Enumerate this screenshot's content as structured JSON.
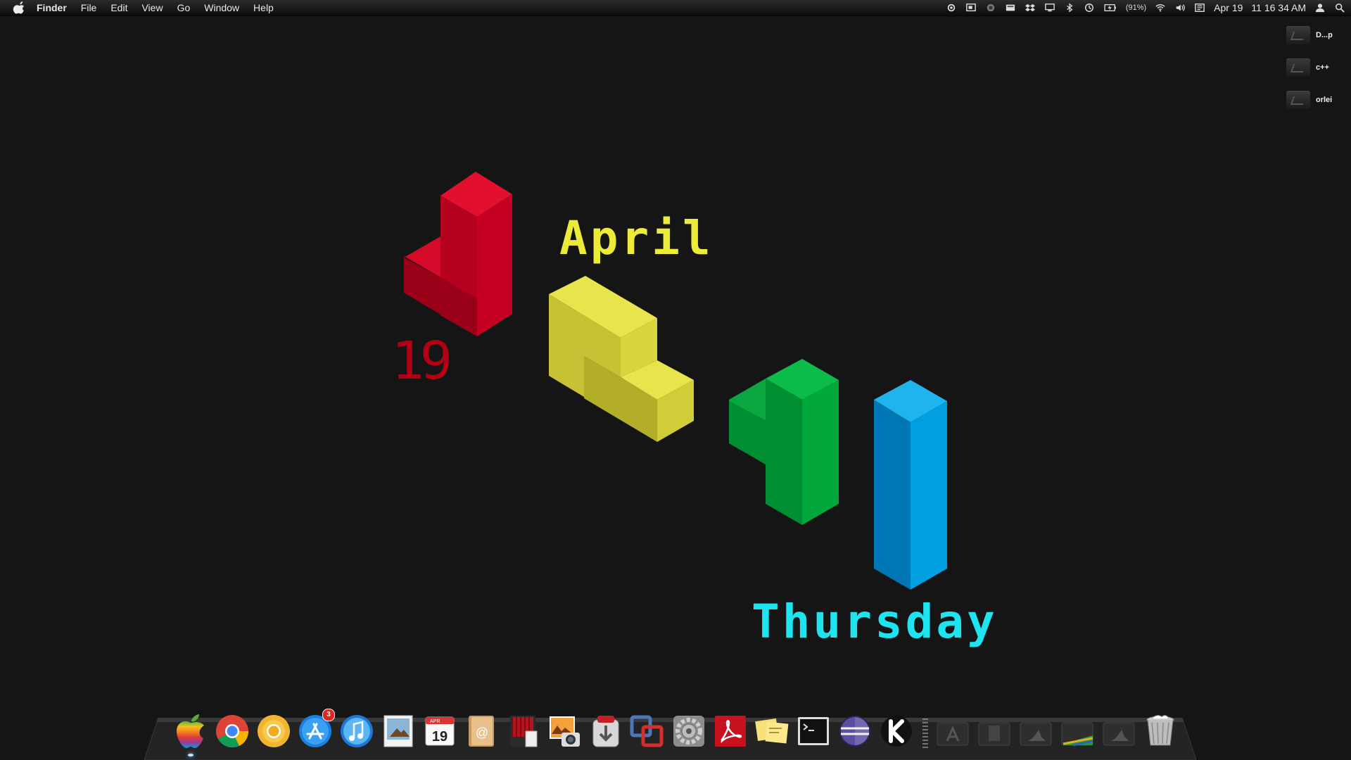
{
  "menubar": {
    "app_name": "Finder",
    "menus": [
      "File",
      "Edit",
      "View",
      "Go",
      "Window",
      "Help"
    ],
    "status_icons": [
      "sync-icon",
      "screen-capture-icon",
      "chat-icon",
      "keyboard-icon",
      "dropbox-icon",
      "display-icon",
      "bluetooth-icon",
      "time-machine-icon",
      "battery-icon",
      "wifi-icon",
      "volume-icon",
      "input-menu-icon"
    ],
    "battery_percent": "(91%)",
    "date": "Apr 19",
    "time": "11 16 34 AM"
  },
  "desktop": {
    "items": [
      {
        "label": "D...p",
        "icon": "drive-icon"
      },
      {
        "label": "c++",
        "icon": "drive-icon"
      },
      {
        "label": "orlei",
        "icon": "drive-icon"
      }
    ]
  },
  "wallpaper_clock": {
    "day_number": "19",
    "month": "April",
    "weekday": "Thursday",
    "colors": {
      "red": "#c0001c",
      "yellow": "#ecec38",
      "green": "#00a83c",
      "blue": "#00a0e0",
      "cyan_text": "#1de4ef"
    }
  },
  "dock": {
    "apps": [
      {
        "name": "finder-icon"
      },
      {
        "name": "chrome-icon"
      },
      {
        "name": "chrome-canary-icon"
      },
      {
        "name": "app-store-icon",
        "badge": "3"
      },
      {
        "name": "itunes-icon"
      },
      {
        "name": "preview-icon"
      },
      {
        "name": "calendar-icon",
        "day": "19",
        "month": "APR"
      },
      {
        "name": "address-book-icon"
      },
      {
        "name": "photo-booth-icon"
      },
      {
        "name": "iphoto-icon"
      },
      {
        "name": "transmission-icon"
      },
      {
        "name": "vmware-icon"
      },
      {
        "name": "system-preferences-icon"
      },
      {
        "name": "acrobat-icon"
      },
      {
        "name": "stickies-icon"
      },
      {
        "name": "terminal-icon"
      },
      {
        "name": "eclipse-icon"
      },
      {
        "name": "komodo-icon"
      }
    ],
    "stacks": [
      "applications-stack-icon",
      "documents-stack-icon",
      "drive-stack-icon",
      "downloads-stack-icon",
      "drive-stack-icon",
      "trash-icon"
    ]
  }
}
